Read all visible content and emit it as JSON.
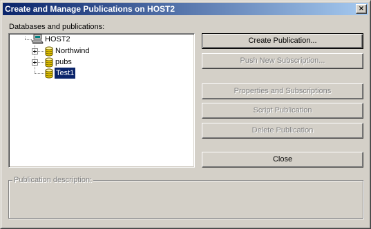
{
  "window": {
    "title": "Create and Manage Publications on HOST2",
    "close_label": "×"
  },
  "tree": {
    "label": "Databases and publications:",
    "server": {
      "name": "HOST2",
      "icon": "server-icon"
    },
    "databases": [
      {
        "name": "Northwind",
        "icon": "database-icon",
        "expandable": true,
        "selected": false
      },
      {
        "name": "pubs",
        "icon": "database-icon",
        "expandable": true,
        "selected": false
      },
      {
        "name": "Test1",
        "icon": "database-icon",
        "expandable": false,
        "selected": true
      }
    ]
  },
  "buttons": {
    "create_publication": {
      "label": "Create Publication...",
      "enabled": true
    },
    "push_new_subscription": {
      "label": "Push New Subscription...",
      "enabled": false
    },
    "properties_and_subscriptions": {
      "label": "Properties and Subscriptions",
      "enabled": false
    },
    "script_publication": {
      "label": "Script Publication",
      "enabled": false
    },
    "delete_publication": {
      "label": "Delete Publication",
      "enabled": false
    },
    "close": {
      "label": "Close",
      "enabled": true
    }
  },
  "description": {
    "label": "Publication description:",
    "text": ""
  },
  "colors": {
    "title_bar_start": "#0a246a",
    "title_bar_end": "#a6caf0",
    "face": "#d4d0c8",
    "selection": "#0a246a",
    "database_icon": "#e8c800"
  }
}
